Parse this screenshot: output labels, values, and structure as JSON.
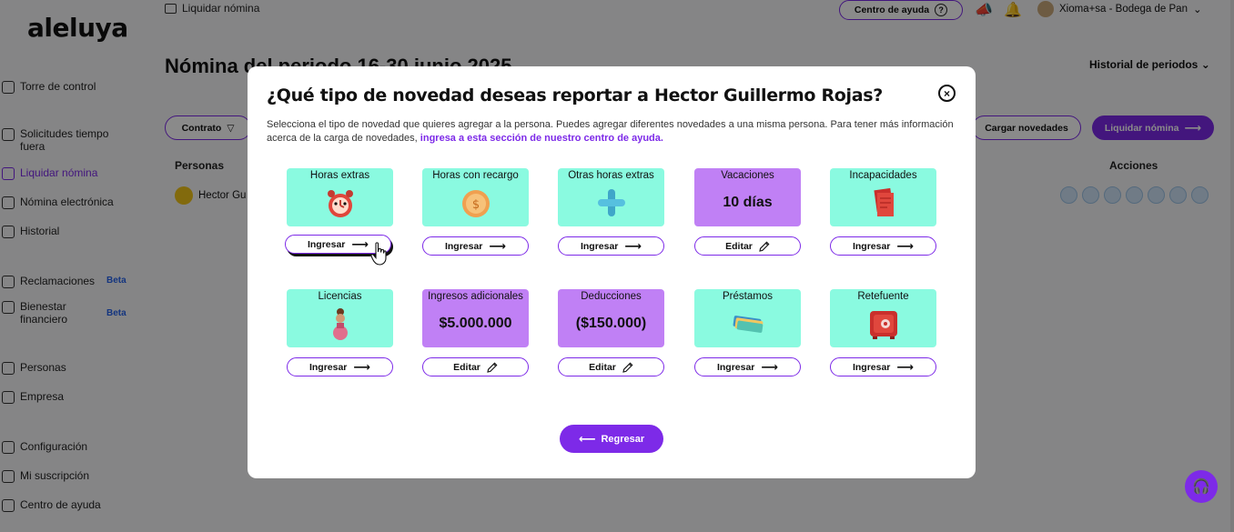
{
  "app": {
    "logo": "aleluya",
    "breadcrumb": "Liquidar nómina",
    "help_label": "Centro de ayuda",
    "help_q": "?",
    "user_name": "Xioma+sa - Bodega de Pan",
    "page_title": "Nómina del periodo 16-30 junio 2025",
    "history_periods": "Historial de periodos",
    "filter_contract": "Contrato",
    "load_novelties": "Cargar novedades",
    "liquidate_payroll": "Liquidar nómina",
    "col_people": "Personas",
    "col_actions": "Acciones",
    "row_person": "Hector Gu",
    "beta": "Beta"
  },
  "sidebar": {
    "items": [
      {
        "label": "Torre de control"
      },
      {
        "label": "Solicitudes tiempo fuera"
      },
      {
        "label": "Liquidar nómina"
      },
      {
        "label": "Nómina electrónica"
      },
      {
        "label": "Historial"
      },
      {
        "label": "Reclamaciones"
      },
      {
        "label": "Bienestar financiero"
      },
      {
        "label": "Personas"
      },
      {
        "label": "Empresa"
      },
      {
        "label": "Configuración"
      },
      {
        "label": "Mi suscripción"
      },
      {
        "label": "Centro de ayuda"
      }
    ]
  },
  "modal": {
    "title": "¿Qué tipo de novedad deseas reportar a Hector Guillermo Rojas?",
    "desc": "Selecciona el tipo de novedad que quieres agregar a la persona. Puedes agregar diferentes novedades a una misma persona. Para tener más información acerca de la carga de novedades,",
    "desc_link": "ingresa a esta sección de nuestro centro de ayuda.",
    "close_glyph": "×",
    "back_label": "Regresar",
    "arrow_right": "⟶",
    "arrow_left": "⟵",
    "cards": [
      {
        "label": "Horas extras",
        "value": "",
        "button": "Ingresar",
        "style": "teal",
        "icon": "alarm-clock-icon",
        "btn_icon": "arrow-right-icon"
      },
      {
        "label": "Horas con recargo",
        "value": "",
        "button": "Ingresar",
        "style": "teal",
        "icon": "coin-icon",
        "btn_icon": "arrow-right-icon"
      },
      {
        "label": "Otras horas extras",
        "value": "",
        "button": "Ingresar",
        "style": "teal",
        "icon": "plus-icon",
        "btn_icon": "arrow-right-icon"
      },
      {
        "label": "Vacaciones",
        "value": "10 días",
        "button": "Editar",
        "style": "purple",
        "icon": "",
        "btn_icon": "pencil-icon"
      },
      {
        "label": "Incapacidades",
        "value": "",
        "button": "Ingresar",
        "style": "teal",
        "icon": "documents-icon",
        "btn_icon": "arrow-right-icon"
      },
      {
        "label": "Licencias",
        "value": "",
        "button": "Ingresar",
        "style": "teal",
        "icon": "person-figure-icon",
        "btn_icon": "arrow-right-icon"
      },
      {
        "label": "Ingresos adicionales",
        "value": "$5.000.000",
        "button": "Editar",
        "style": "purple",
        "icon": "",
        "btn_icon": "pencil-icon"
      },
      {
        "label": "Deducciones",
        "value": "($150.000)",
        "button": "Editar",
        "style": "purple",
        "icon": "",
        "btn_icon": "pencil-icon"
      },
      {
        "label": "Préstamos",
        "value": "",
        "button": "Ingresar",
        "style": "teal",
        "icon": "cash-stack-icon",
        "btn_icon": "arrow-right-icon"
      },
      {
        "label": "Retefuente",
        "value": "",
        "button": "Ingresar",
        "style": "teal",
        "icon": "safe-icon",
        "btn_icon": "arrow-right-icon"
      }
    ]
  },
  "colors": {
    "accent": "#7d2ae8",
    "teal": "#8afae0",
    "purple": "#c080f5"
  }
}
